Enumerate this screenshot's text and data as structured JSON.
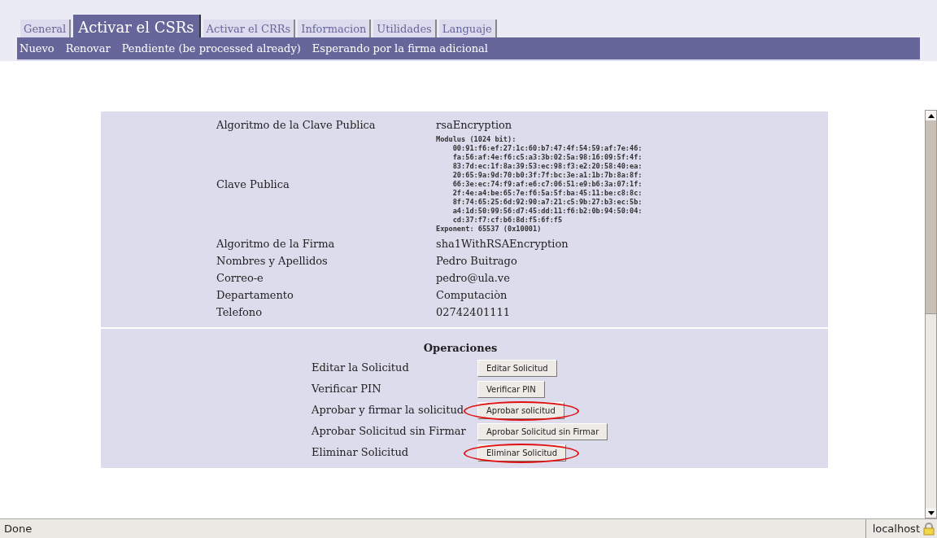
{
  "tabs": [
    {
      "label": "General",
      "selected": false
    },
    {
      "label": "Activar el CSRs",
      "selected": true
    },
    {
      "label": "Activar el CRRs",
      "selected": false
    },
    {
      "label": "Informacion",
      "selected": false
    },
    {
      "label": "Utilidades",
      "selected": false
    },
    {
      "label": "Languaje",
      "selected": false
    }
  ],
  "subnav": [
    "Nuevo",
    "Renovar",
    "Pendiente (be processed already)",
    "Esperando por la firma adicional"
  ],
  "fields": [
    {
      "kind": "text",
      "label": "Algoritmo de la Clave Publica",
      "value": "rsaEncryption"
    },
    {
      "kind": "code",
      "label": "Clave Publica",
      "lines": [
        "Modulus (1024 bit):",
        "    00:91:f6:ef:27:1c:60:b7:47:4f:54:59:af:7e:46:",
        "    fa:56:af:4e:f6:c5:a3:3b:02:5a:98:16:09:5f:4f:",
        "    83:7d:ec:1f:8a:39:53:ec:98:f3:e2:20:58:40:ea:",
        "    20:65:9a:9d:70:b0:3f:7f:bc:3e:a1:1b:7b:8a:8f:",
        "    66:3e:ec:74:f9:af:e6:c7:06:51:e9:b6:3a:07:1f:",
        "    2f:4e:a4:be:65:7e:f6:5a:5f:ba:45:11:be:c8:8c:",
        "    8f:74:65:25:6d:92:90:a7:21:c5:9b:27:b3:ec:5b:",
        "    a4:1d:50:99:56:d7:45:dd:11:f6:b2:0b:94:50:04:",
        "    cd:37:f7:cf:b6:8d:f5:6f:f5",
        "Exponent: 65537 (0x10001)"
      ]
    },
    {
      "kind": "text",
      "label": "Algoritmo de la Firma",
      "value": "sha1WithRSAEncryption"
    },
    {
      "kind": "text",
      "label": "Nombres y Apellidos",
      "value": "Pedro Buitrago"
    },
    {
      "kind": "text",
      "label": "Correo-e",
      "value": "pedro@ula.ve"
    },
    {
      "kind": "text",
      "label": "Departamento",
      "value": "Computaciòn"
    },
    {
      "kind": "text",
      "label": "Telefono",
      "value": "02742401111"
    }
  ],
  "operations": {
    "title": "Operaciones",
    "rows": [
      {
        "label": "Editar la Solicitud",
        "button": "Editar Solicitud",
        "circled": false
      },
      {
        "label": "Verificar PIN",
        "button": "Verificar PIN",
        "circled": false
      },
      {
        "label": "Aprobar y firmar la solicitud",
        "button": "Aprobar solicitud",
        "circled": true
      },
      {
        "label": "Aprobar Solicitud sin Firmar",
        "button": "Aprobar Solicitud sin Firmar",
        "circled": false
      },
      {
        "label": "Eliminar Solicitud",
        "button": "Eliminar Solicitud",
        "circled": true
      }
    ]
  },
  "status_bar": {
    "text": "Done",
    "host": "localhost"
  }
}
